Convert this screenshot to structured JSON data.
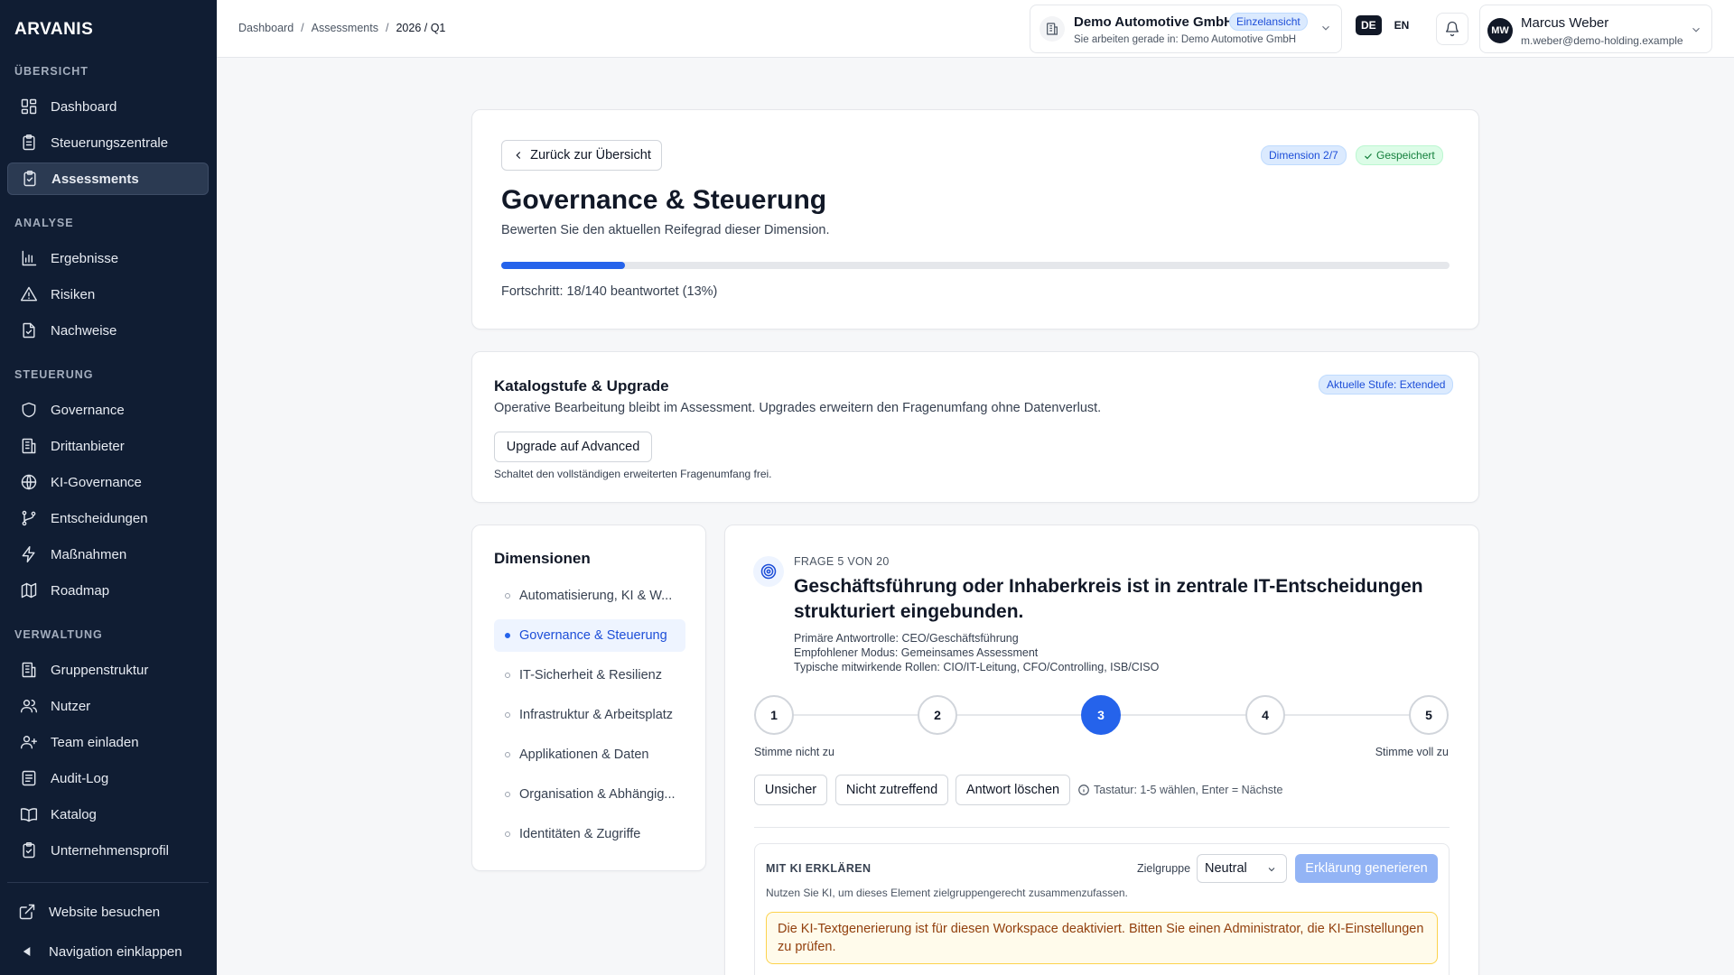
{
  "app": {
    "logo": "ARVANIS"
  },
  "sidebar": {
    "sections": [
      {
        "title": "ÜBERSICHT",
        "items": [
          {
            "label": "Dashboard",
            "icon": "dashboard-icon"
          },
          {
            "label": "Steuerungszentrale",
            "icon": "clipboard-icon"
          },
          {
            "label": "Assessments",
            "icon": "clipboard-check-icon",
            "active": true
          }
        ]
      },
      {
        "title": "ANALYSE",
        "items": [
          {
            "label": "Ergebnisse",
            "icon": "bar-chart-icon"
          },
          {
            "label": "Risiken",
            "icon": "warning-icon"
          },
          {
            "label": "Nachweise",
            "icon": "file-check-icon"
          }
        ]
      },
      {
        "title": "STEUERUNG",
        "items": [
          {
            "label": "Governance",
            "icon": "shield-icon"
          },
          {
            "label": "Drittanbieter",
            "icon": "building-icon"
          },
          {
            "label": "KI-Governance",
            "icon": "globe-icon"
          },
          {
            "label": "Entscheidungen",
            "icon": "git-branch-icon"
          },
          {
            "label": "Maßnahmen",
            "icon": "lightning-icon"
          },
          {
            "label": "Roadmap",
            "icon": "map-icon"
          }
        ]
      },
      {
        "title": "VERWALTUNG",
        "items": [
          {
            "label": "Gruppenstruktur",
            "icon": "building-icon"
          },
          {
            "label": "Nutzer",
            "icon": "users-icon"
          },
          {
            "label": "Team einladen",
            "icon": "user-plus-icon"
          },
          {
            "label": "Audit-Log",
            "icon": "list-icon"
          },
          {
            "label": "Katalog",
            "icon": "book-icon"
          },
          {
            "label": "Unternehmensprofil",
            "icon": "clipboard-check-icon"
          }
        ]
      }
    ],
    "visit_website": "Website besuchen",
    "collapse": "Navigation einklappen"
  },
  "topbar": {
    "breadcrumb": [
      "Dashboard",
      "Assessments",
      "2026 / Q1"
    ],
    "workspace": {
      "name": "Demo Automotive GmbH",
      "badge": "Einzelansicht",
      "sub": "Sie arbeiten gerade in: Demo Automotive GmbH"
    },
    "lang_active": "DE",
    "lang_other": "EN",
    "user": {
      "initials": "MW",
      "name": "Marcus Weber",
      "email": "m.weber@demo-holding.example"
    }
  },
  "header_card": {
    "back": "Zurück zur Übersicht",
    "dimension_badge": "Dimension 2/7",
    "saved_badge": "Gespeichert",
    "title": "Governance & Steuerung",
    "subtitle": "Bewerten Sie den aktuellen Reifegrad dieser Dimension.",
    "progress_fraction": 0.13,
    "progress_text": "Fortschritt: 18/140 beantwortet (13%)"
  },
  "catalog_card": {
    "title": "Katalogstufe & Upgrade",
    "badge": "Aktuelle Stufe: Extended",
    "desc": "Operative Bearbeitung bleibt im Assessment. Upgrades erweitern den Fragenumfang ohne Datenverlust.",
    "button": "Upgrade auf Advanced",
    "hint": "Schaltet den vollständigen erweiterten Fragenumfang frei."
  },
  "dimensions": {
    "title": "Dimensionen",
    "items": [
      {
        "label": "Automatisierung, KI & W..."
      },
      {
        "label": "Governance & Steuerung",
        "selected": true
      },
      {
        "label": "IT-Sicherheit & Resilienz"
      },
      {
        "label": "Infrastruktur & Arbeitsplatz"
      },
      {
        "label": "Applikationen & Daten"
      },
      {
        "label": "Organisation & Abhängig..."
      },
      {
        "label": "Identitäten & Zugriffe"
      }
    ]
  },
  "question": {
    "counter": "FRAGE 5 VON 20",
    "text": "Geschäftsführung oder Inhaberkreis ist in zentrale IT-Entscheidungen strukturiert eingebunden.",
    "meta": [
      "Primäre Antwortrolle: CEO/Geschäftsführung",
      "Empfohlener Modus: Gemeinsames Assessment",
      "Typische mitwirkende Rollen: CIO/IT-Leitung, CFO/Controlling, ISB/CISO"
    ],
    "scale": [
      "1",
      "2",
      "3",
      "4",
      "5"
    ],
    "selected_value": 3,
    "scale_low": "Stimme nicht zu",
    "scale_high": "Stimme voll zu",
    "buttons": [
      "Unsicher",
      "Nicht zutreffend",
      "Antwort löschen"
    ],
    "keyboard_hint": "Tastatur: 1-5 wählen, Enter = Nächste"
  },
  "ai": {
    "title": "MIT KI ERKLÄREN",
    "target_label": "Zielgruppe",
    "target_value": "Neutral",
    "generate": "Erklärung generieren",
    "desc": "Nutzen Sie KI, um dieses Element zielgruppengerecht zusammenzufassen.",
    "warning": "Die KI-Textgenerierung ist für diesen Workspace deaktiviert. Bitten Sie einen Administrator, die KI-Einstellungen zu prüfen."
  },
  "colors": {
    "sidebar_bg": "#101d33",
    "accent": "#2563eb",
    "success": "#15803d",
    "warning_bg": "#fffbeb"
  }
}
